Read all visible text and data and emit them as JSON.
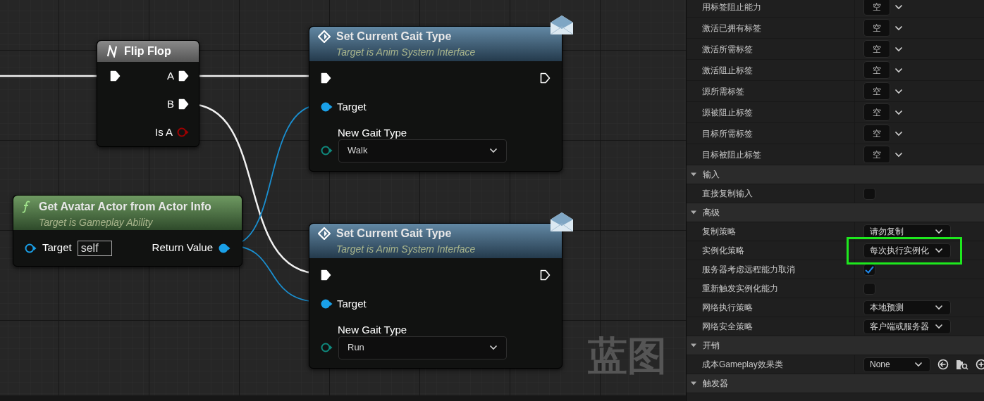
{
  "graph": {
    "nodes": [
      {
        "kind": "macro",
        "title": "Flip Flop",
        "exec_in": {
          "connected": true
        },
        "outputs": [
          {
            "kind": "exec",
            "label": "A",
            "connected": true
          },
          {
            "kind": "exec",
            "label": "B",
            "connected": true
          },
          {
            "kind": "bool",
            "label": "Is A",
            "connected": false
          }
        ]
      },
      {
        "kind": "function",
        "title": "Get Avatar Actor from Actor Info",
        "subtitle": "Target is Gameplay Ability",
        "input": {
          "label": "Target",
          "value": "self",
          "connected": false
        },
        "output": {
          "label": "Return Value",
          "connected": true
        }
      },
      {
        "kind": "message",
        "title": "Set Current Gait Type",
        "subtitle": "Target is Anim System Interface",
        "exec_in": {
          "connected": true
        },
        "exec_out": {
          "connected": false
        },
        "target": {
          "label": "Target",
          "connected": true
        },
        "param": {
          "label": "New Gait Type",
          "value": "Walk",
          "connected": false
        }
      },
      {
        "kind": "message",
        "title": "Set Current Gait Type",
        "subtitle": "Target is Anim System Interface",
        "exec_in": {
          "connected": true
        },
        "exec_out": {
          "connected": false
        },
        "target": {
          "label": "Target",
          "connected": true
        },
        "param": {
          "label": "New Gait Type",
          "value": "Run",
          "connected": false
        }
      }
    ],
    "graph_label": "蓝图"
  },
  "details": {
    "rows": [
      {
        "kind": "tag",
        "label": "用标签阻止能力",
        "value": "空"
      },
      {
        "kind": "tag",
        "label": "激活已拥有标签",
        "value": "空"
      },
      {
        "kind": "tag",
        "label": "激活所需标签",
        "value": "空"
      },
      {
        "kind": "tag",
        "label": "激活阻止标签",
        "value": "空"
      },
      {
        "kind": "tag",
        "label": "源所需标签",
        "value": "空"
      },
      {
        "kind": "tag",
        "label": "源被阻止标签",
        "value": "空"
      },
      {
        "kind": "tag",
        "label": "目标所需标签",
        "value": "空"
      },
      {
        "kind": "tag",
        "label": "目标被阻止标签",
        "value": "空"
      },
      {
        "kind": "section",
        "label": "输入",
        "expanded": true
      },
      {
        "kind": "checkbox",
        "label": "直接复制输入",
        "checked": false
      },
      {
        "kind": "section",
        "label": "高级",
        "expanded": true
      },
      {
        "kind": "dropdown",
        "label": "复制策略",
        "value": "请勿复制",
        "highlighted": false
      },
      {
        "kind": "dropdown",
        "label": "实例化策略",
        "value": "每次执行实例化",
        "highlighted": true
      },
      {
        "kind": "checkbox",
        "label": "服务器考虑远程能力取消",
        "checked": true
      },
      {
        "kind": "checkbox",
        "label": "重新触发实例化能力",
        "checked": false
      },
      {
        "kind": "dropdown",
        "label": "网络执行策略",
        "value": "本地预测",
        "highlighted": false
      },
      {
        "kind": "dropdown",
        "label": "网络安全策略",
        "value": "客户端或服务器",
        "highlighted": false
      },
      {
        "kind": "section",
        "label": "开销",
        "expanded": true
      },
      {
        "kind": "class",
        "label": "成本Gameplay效果类",
        "value": "None"
      },
      {
        "kind": "section",
        "label": "触发器",
        "expanded": true
      }
    ]
  }
}
